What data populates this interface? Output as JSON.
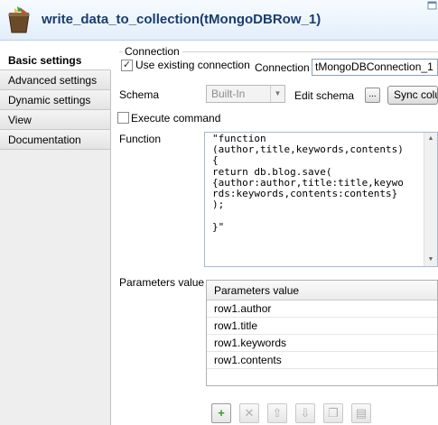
{
  "window": {
    "title": "write_data_to_collection(tMongoDBRow_1)",
    "logo_icon": "talend-component-cup-icon",
    "corner_icon": "maximize-icon"
  },
  "sidebar": {
    "tabs": [
      {
        "label": "Basic settings",
        "active": true
      },
      {
        "label": "Advanced settings",
        "active": false
      },
      {
        "label": "Dynamic settings",
        "active": false
      },
      {
        "label": "View",
        "active": false
      },
      {
        "label": "Documentation",
        "active": false
      }
    ]
  },
  "connection": {
    "group_label": "Connection",
    "use_existing_label": "Use existing connection",
    "use_existing_checked": true,
    "check_mark": "✓",
    "connection_label": "Connection",
    "connection_value": "tMongoDBConnection_1"
  },
  "schema": {
    "label": "Schema",
    "value": "Built-In",
    "edit_label": "Edit schema",
    "edit_button": "...",
    "sync_label": "Sync columns"
  },
  "execute": {
    "label": "Execute command",
    "checked": false
  },
  "function": {
    "label": "Function",
    "code": "\"function\n(author,title,keywords,contents)\n{\nreturn db.blog.save(\n{author:author,title:title,keywo\nrds:keywords,contents:contents}\n);\n\n}\""
  },
  "parameters": {
    "label": "Parameters value",
    "column_header": "Parameters value",
    "rows": [
      "row1.author",
      "row1.title",
      "row1.keywords",
      "row1.contents"
    ]
  },
  "toolbar": {
    "buttons": [
      {
        "name": "add-icon",
        "glyph": "+",
        "enabled": true
      },
      {
        "name": "remove-icon",
        "glyph": "✕",
        "enabled": false
      },
      {
        "name": "move-up-icon",
        "glyph": "⇧",
        "enabled": false
      },
      {
        "name": "move-down-icon",
        "glyph": "⇩",
        "enabled": false
      },
      {
        "name": "copy-icon",
        "glyph": "❐",
        "enabled": false
      },
      {
        "name": "paste-icon",
        "glyph": "▤",
        "enabled": false
      }
    ]
  },
  "colors": {
    "title_text": "#1a3d6e",
    "add_icon": "#2e9c2e"
  }
}
